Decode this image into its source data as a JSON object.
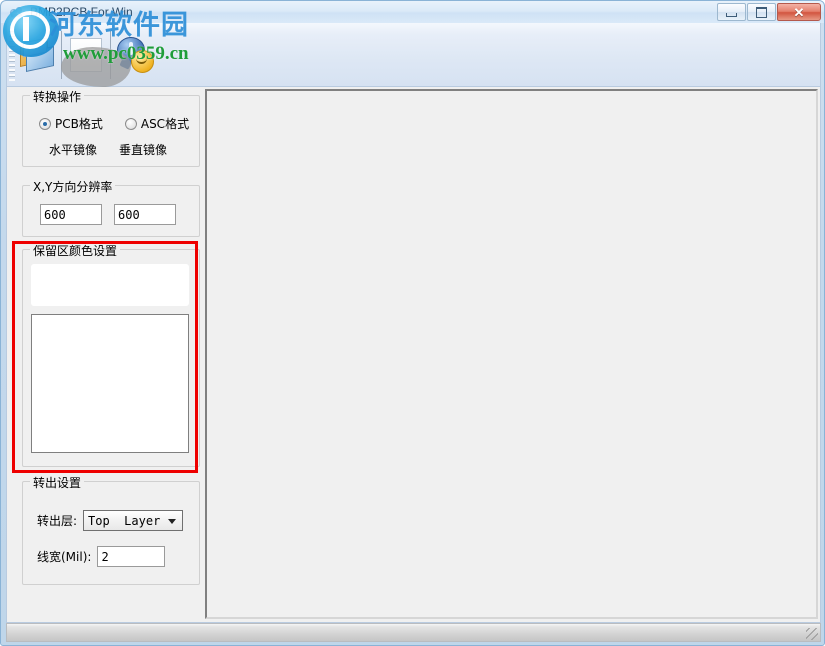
{
  "window": {
    "title": "BMP2PCB For Win",
    "icon": "app-pcb-icon",
    "accent_blue": "#2a6ca8",
    "frame_blue": "#bfd6ea",
    "highlight_red": "#ee0000"
  },
  "titlebar_buttons": {
    "minimize_glyph": "–",
    "maximize_glyph": "□",
    "close_glyph": "✕",
    "minimize_name": "minimize",
    "maximize_name": "maximize",
    "close_name": "close"
  },
  "toolbar": {
    "buttons": [
      {
        "icon": "open-file-icon",
        "label": ""
      },
      {
        "icon": "blank-page-icon",
        "label": ""
      },
      {
        "icon": "chat-smiley-icon",
        "label": ""
      }
    ]
  },
  "watermark": {
    "site_cn": "河东软件园",
    "site_url": "www.pc0359.cn"
  },
  "panels": {
    "convert": {
      "title": "转换操作",
      "radios": [
        {
          "label": "PCB格式",
          "checked": true
        },
        {
          "label": "ASC格式",
          "checked": false
        }
      ],
      "mirror_buttons": [
        {
          "label": "水平镜像"
        },
        {
          "label": "垂直镜像"
        }
      ]
    },
    "resolution": {
      "title": "X,Y方向分辨率",
      "x_value": "600",
      "y_value": "600",
      "placeholder": ""
    },
    "reserve_color": {
      "title": "保留区颜色设置",
      "preview_color": "#ffffff",
      "list_items": []
    },
    "export": {
      "title": "转出设置",
      "layer_label": "转出层:",
      "layer_value": "Top  Layer",
      "layer_options": [
        "Top  Layer"
      ],
      "width_label": "线宽(Mil):",
      "width_value": "2"
    }
  },
  "canvas": {
    "content": ""
  },
  "statusbar": {
    "text": ""
  }
}
